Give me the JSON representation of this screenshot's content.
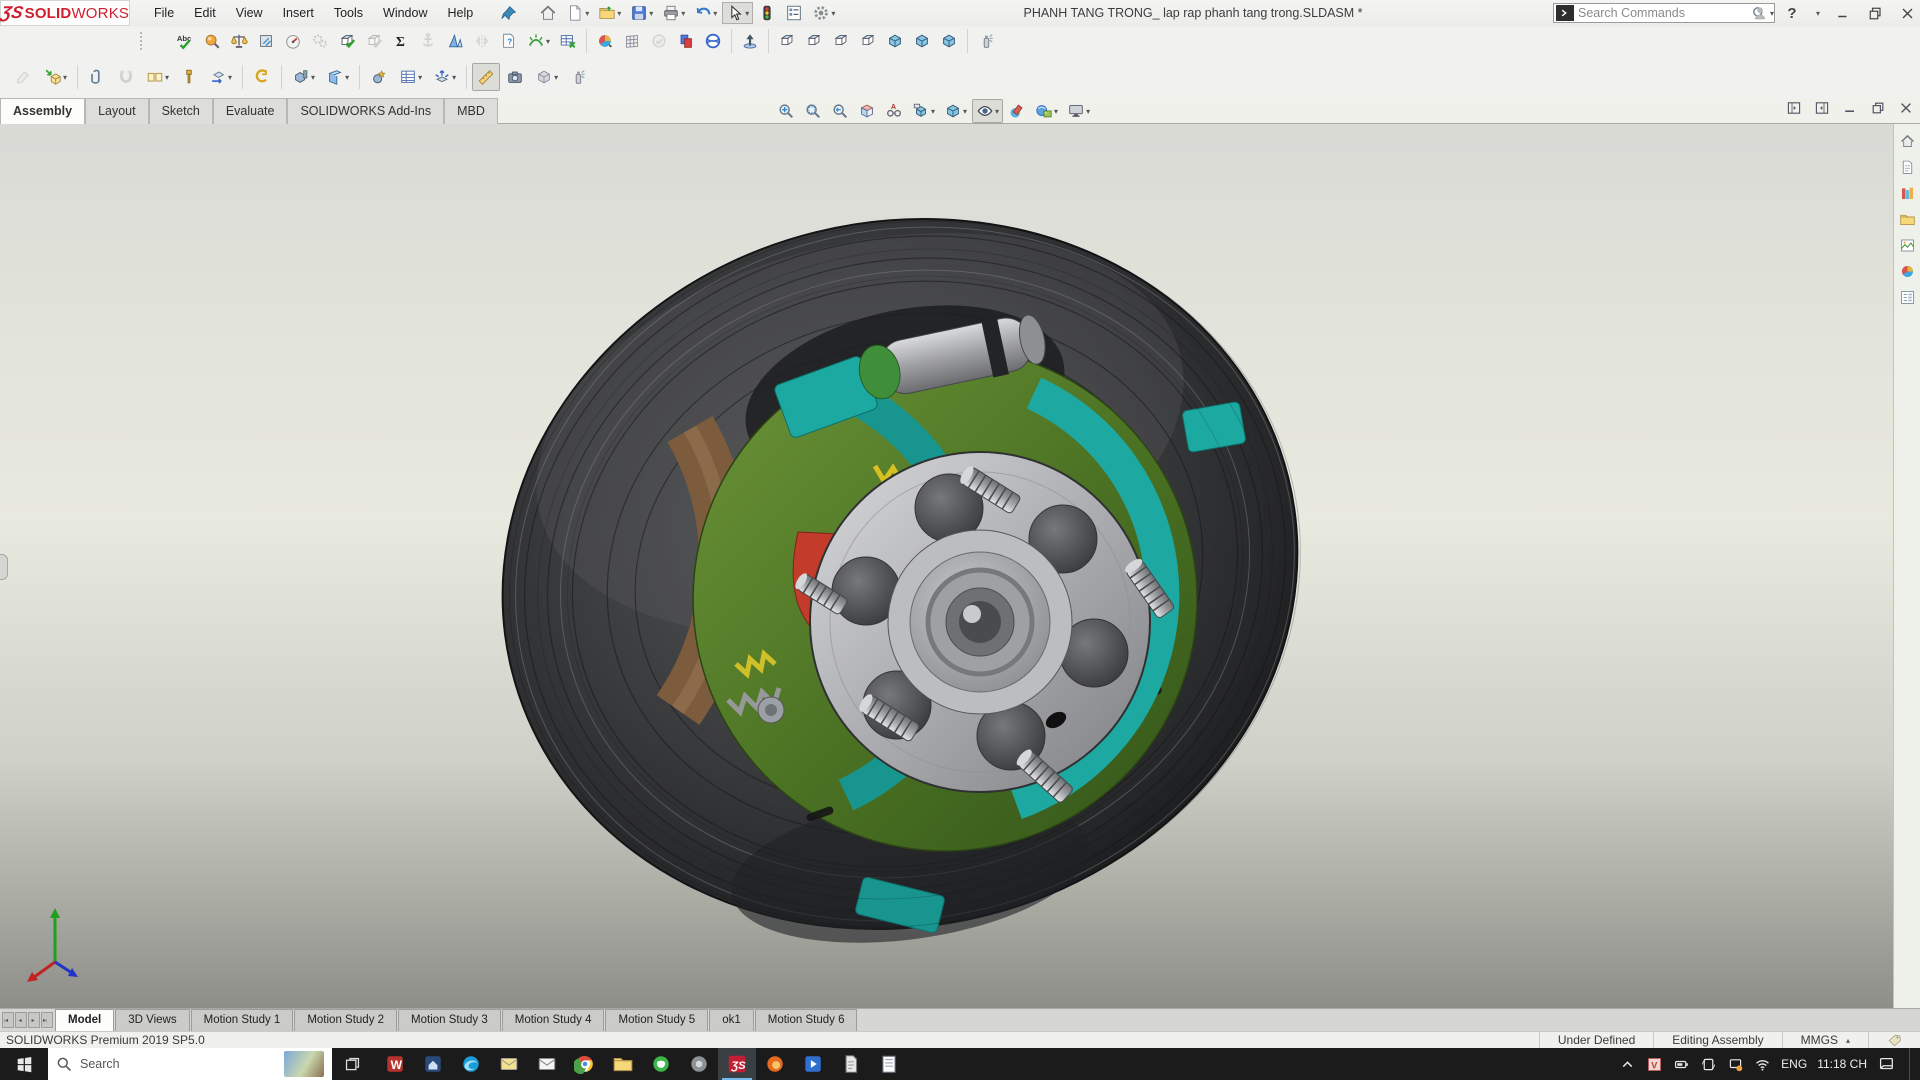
{
  "colors": {
    "accent_red": "#cf1f2e",
    "teal_shoe": "#1da8a1",
    "green_plate": "#4a7122",
    "drum_grey": "#2f3032",
    "hub_silver": "#b9babc",
    "brown_pad": "#7d5c3e",
    "taskbar_bg": "#1b1b1b",
    "active_underline": "#76b9ed"
  },
  "titlebar": {
    "logo_bold": "SOLID",
    "logo_rest": "WORKS",
    "menus": [
      "File",
      "Edit",
      "View",
      "Insert",
      "Tools",
      "Window",
      "Help"
    ],
    "title": "PHANH TANG TRONG_ lap rap phanh tang trong.SLDASM *",
    "search_placeholder": "Search Commands",
    "quick_access": [
      {
        "icon": "home"
      },
      {
        "icon": "new-document",
        "dd": true
      },
      {
        "icon": "open-file",
        "dd": true
      },
      {
        "icon": "save",
        "dd": true
      },
      {
        "icon": "print",
        "dd": true
      },
      {
        "icon": "undo",
        "dd": true
      },
      {
        "icon": "select-cursor",
        "dd": true,
        "pressed": true
      },
      {
        "icon": "rebuild-traffic-light"
      },
      {
        "icon": "file-properties"
      },
      {
        "icon": "options-gear",
        "dd": true
      }
    ],
    "window_controls": [
      "user-account",
      "help-question",
      "help-dropdown",
      "minimize",
      "restore",
      "close"
    ]
  },
  "toolbar_evaluate": [
    {
      "icon": "spell-check"
    },
    {
      "icon": "design-binder-magnifier"
    },
    {
      "icon": "mass-properties"
    },
    {
      "icon": "section-properties"
    },
    {
      "icon": "performance-evaluation"
    },
    {
      "icon": "gears",
      "disabled": true
    },
    {
      "icon": "check-document"
    },
    {
      "icon": "check-document-grey",
      "disabled": true
    },
    {
      "icon": "equations"
    },
    {
      "icon": "anchor",
      "disabled": true
    },
    {
      "icon": "draft-analysis"
    },
    {
      "icon": "symmetry-check",
      "disabled": true
    },
    {
      "icon": "doc-question"
    },
    {
      "icon": "curvature",
      "dd": true
    },
    {
      "icon": "design-table"
    },
    {
      "sep": true
    },
    {
      "icon": "realview"
    },
    {
      "icon": "mesh-quality"
    },
    {
      "icon": "check-circle",
      "disabled": true
    },
    {
      "icon": "compare-documents"
    },
    {
      "icon": "sync-ball"
    },
    {
      "sep": true
    },
    {
      "icon": "section-up-arrow"
    },
    {
      "sep": true
    },
    {
      "icon": "view-cube-front"
    },
    {
      "icon": "view-cube-back"
    },
    {
      "icon": "view-cube-left"
    },
    {
      "icon": "view-cube-right"
    },
    {
      "icon": "view-cube-isometric"
    },
    {
      "icon": "view-cube-dimetric"
    },
    {
      "icon": "view-cube-trimetric"
    },
    {
      "sep": true
    },
    {
      "icon": "apply-appearance-spray"
    }
  ],
  "toolbar_assembly": [
    {
      "icon": "edit-component",
      "disabled": true
    },
    {
      "icon": "insert-components",
      "dd": true
    },
    {
      "sep": true
    },
    {
      "icon": "mate"
    },
    {
      "icon": "magnetic-mate",
      "disabled": true
    },
    {
      "icon": "linear-component-pattern",
      "dd": true
    },
    {
      "icon": "smart-fasteners"
    },
    {
      "icon": "move-component",
      "dd": true
    },
    {
      "sep": true
    },
    {
      "icon": "show-hidden-components"
    },
    {
      "sep": true
    },
    {
      "icon": "assembly-features",
      "dd": true
    },
    {
      "icon": "reference-geometry",
      "dd": true
    },
    {
      "sep": true
    },
    {
      "icon": "new-motion-study"
    },
    {
      "icon": "bill-of-materials",
      "dd": true
    },
    {
      "icon": "exploded-view",
      "dd": true
    },
    {
      "sep": true
    },
    {
      "icon": "instant3d-ruler",
      "pressed": true
    },
    {
      "icon": "take-snapshot"
    },
    {
      "icon": "large-assembly-mode",
      "dd": true
    },
    {
      "icon": "appearance-spray2"
    }
  ],
  "command_tabs": {
    "items": [
      "Assembly",
      "Layout",
      "Sketch",
      "Evaluate",
      "SOLIDWORKS Add-Ins",
      "MBD"
    ],
    "active_index": 0
  },
  "headsup": [
    {
      "icon": "zoom-to-fit"
    },
    {
      "icon": "zoom-to-area"
    },
    {
      "icon": "previous-view"
    },
    {
      "icon": "section-view"
    },
    {
      "icon": "dynamic-annotation-views"
    },
    {
      "icon": "view-orientation",
      "dd": true
    },
    {
      "icon": "display-style",
      "dd": true
    },
    {
      "icon": "hide-show-items",
      "dd": true,
      "pressed": true
    },
    {
      "icon": "edit-appearance"
    },
    {
      "icon": "apply-scene",
      "dd": true
    },
    {
      "icon": "view-settings",
      "dd": true
    }
  ],
  "doc_window_controls": [
    "pane-collapse-left",
    "pane-collapse-right",
    "doc-minimize",
    "doc-restore",
    "doc-close"
  ],
  "task_pane": {
    "icons": [
      "taskpane-home",
      "solidworks-resources",
      "design-library",
      "file-explorer-pane",
      "view-palette",
      "appearances-scenes",
      "custom-properties"
    ]
  },
  "model_tabs": {
    "nav": [
      "tab-first",
      "tab-prev",
      "tab-next",
      "tab-last"
    ],
    "items": [
      "Model",
      "3D Views",
      "Motion Study 1",
      "Motion Study 2",
      "Motion Study 3",
      "Motion Study 4",
      "Motion Study 5",
      "ok1",
      "Motion Study 6"
    ],
    "active_index": 0
  },
  "statusbar": {
    "left": "SOLIDWORKS Premium 2019 SP5.0",
    "fields": [
      {
        "text": "Under Defined"
      },
      {
        "text": "Editing Assembly"
      },
      {
        "text": "MMGS",
        "caret": true
      }
    ],
    "right_icon": "tag"
  },
  "taskbar": {
    "search_placeholder": "Search",
    "apps": [
      {
        "icon": "app-red"
      },
      {
        "icon": "app-home-blue"
      },
      {
        "icon": "app-edge"
      },
      {
        "icon": "app-mail-yellow"
      },
      {
        "icon": "app-envelope"
      },
      {
        "icon": "app-chrome"
      },
      {
        "icon": "app-folder"
      },
      {
        "icon": "app-green-messenger"
      },
      {
        "icon": "app-grey-circle"
      },
      {
        "icon": "app-solidworks",
        "active": true
      },
      {
        "icon": "app-firefox"
      },
      {
        "icon": "app-media-blue"
      },
      {
        "icon": "app-doc-grey"
      },
      {
        "icon": "app-notepad"
      }
    ],
    "tray_icons": [
      "chevron-up",
      "tray-v",
      "tray-battery",
      "tray-rotate",
      "tray-tablet",
      "tray-wifi"
    ],
    "language": "ENG",
    "time": "11:18 CH",
    "notification_icon": "notification"
  },
  "viewport": {
    "description": "Drum brake assembly - transparent dark drum, green backing plate, teal brake shoes, brown lining, silver hub with wheel studs"
  }
}
